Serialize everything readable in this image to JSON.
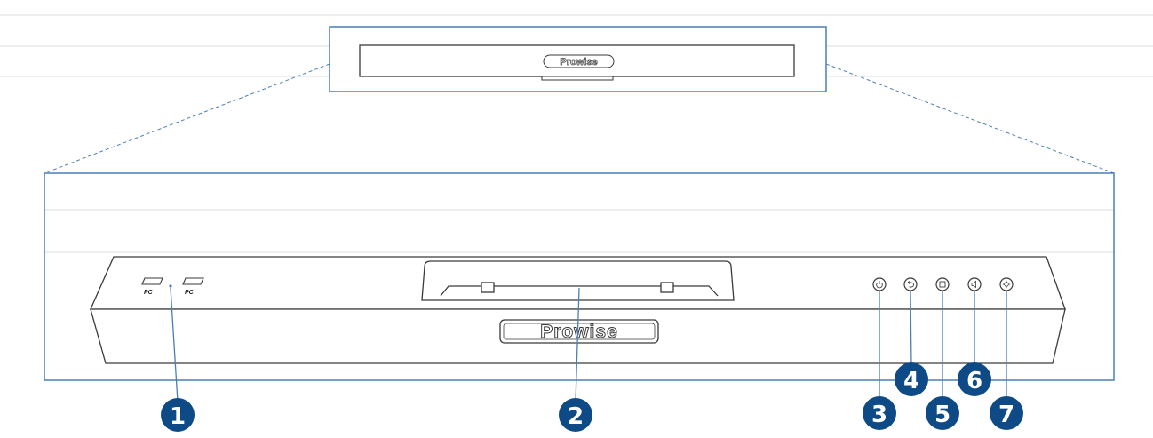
{
  "colors": {
    "outline": "#4a7fb5",
    "panel_line": "#3a3a3a",
    "guide_line": "#d8dce2",
    "callout_fill": "#0e4a86",
    "callout_text": "#ffffff"
  },
  "top_view": {
    "logo": "Prowise"
  },
  "front_view": {
    "logo": "Prowise",
    "ports": [
      {
        "label": "PC",
        "icon": "usb-port-icon"
      },
      {
        "label": "PC",
        "icon": "usb-port-icon"
      }
    ],
    "buttons": [
      {
        "icon": "power-button-icon"
      },
      {
        "icon": "return-button-icon"
      },
      {
        "icon": "menu-button-icon"
      },
      {
        "icon": "volume-button-icon"
      },
      {
        "icon": "settings-button-icon"
      }
    ]
  },
  "callouts": [
    "1",
    "2",
    "3",
    "4",
    "5",
    "6",
    "7"
  ]
}
